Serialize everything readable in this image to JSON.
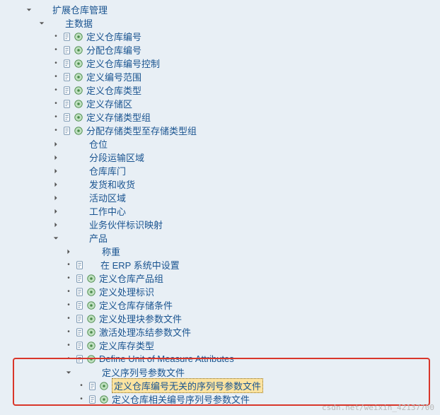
{
  "tree": {
    "n0": "扩展仓库管理",
    "n1": "主数据",
    "n2": "定义仓库编号",
    "n3": "分配仓库编号",
    "n4": "定义仓库编号控制",
    "n5": "定义编号范围",
    "n6": "定义仓库类型",
    "n7": "定义存储区",
    "n8": "定义存储类型组",
    "n9": "分配存储类型至存储类型组",
    "n10": "仓位",
    "n11": "分段运输区域",
    "n12": "仓库库门",
    "n13": "发货和收货",
    "n14": "活动区域",
    "n15": "工作中心",
    "n16": "业务伙伴标识映射",
    "n17": "产品",
    "n18": "称重",
    "n19": "在 ERP 系统中设置",
    "n20": "定义仓库产品组",
    "n21": "定义处理标识",
    "n22": "定义仓库存储条件",
    "n23": "定义处理块参数文件",
    "n24": "激活处理冻结参数文件",
    "n25": "定义库存类型",
    "n26": "Define Unit of Measure Attributes",
    "n27": "定义序列号参数文件",
    "n28": "定义仓库编号无关的序列号参数文件",
    "n29": "定义仓库相关编号序列号参数文件"
  },
  "watermark": "csdn.net/weixin_42137700"
}
